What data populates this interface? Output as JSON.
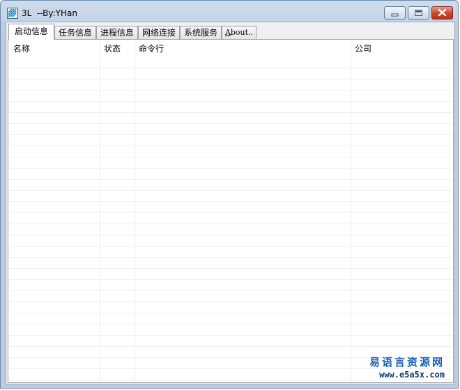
{
  "window": {
    "title": "3L  --By:YHan"
  },
  "tabs": [
    {
      "label": "启动信息",
      "active": true
    },
    {
      "label": "任务信息",
      "active": false
    },
    {
      "label": "进程信息",
      "active": false
    },
    {
      "label": "网络连接",
      "active": false
    },
    {
      "label": "系统服务",
      "active": false
    },
    {
      "label_underlined": "A",
      "label_rest": "bout..",
      "active": false
    }
  ],
  "list": {
    "columns": [
      "名称",
      "状态",
      "命令行",
      "公司"
    ],
    "rows": []
  },
  "watermark": {
    "line1": "易语言资源网",
    "line2": "www.e5a5x.com"
  },
  "colors": {
    "title_bar": "#c3d3e7",
    "close_button": "#c7452a",
    "watermark": "#1a5fb4"
  },
  "icons": {
    "app": "app-logo-icon",
    "minimize": "minimize-icon",
    "maximize": "maximize-icon",
    "close": "close-icon"
  }
}
